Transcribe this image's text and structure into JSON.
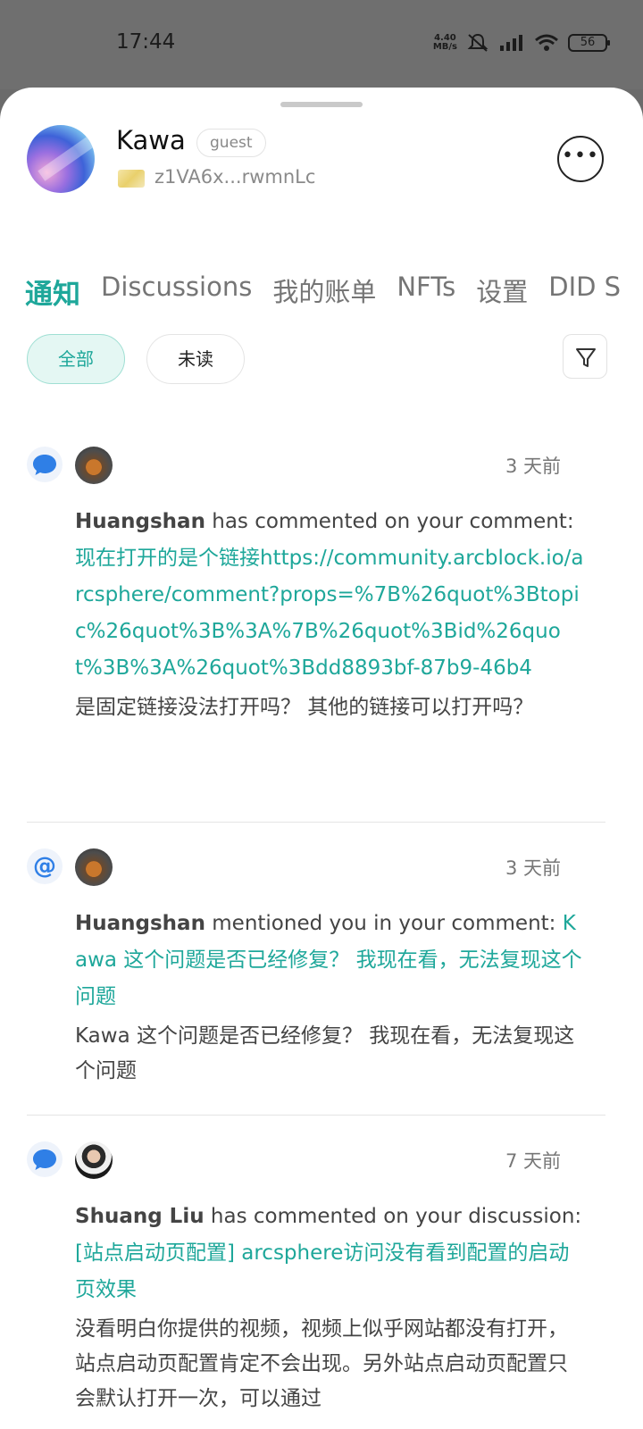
{
  "status": {
    "time": "17:44",
    "speed_top": "4.40",
    "speed_bottom": "MB/s",
    "battery": "56"
  },
  "profile": {
    "name": "Kawa",
    "role": "guest",
    "address": "z1VA6x...rwmnLc"
  },
  "tabs": [
    "通知",
    "Discussions",
    "我的账单",
    "NFTs",
    "设置",
    "DID S"
  ],
  "filters": [
    "全部",
    "未读"
  ],
  "notifications": [
    {
      "type": "comment",
      "time": "3 天前",
      "user": "Huangshan",
      "action": " has commented on your comment: ",
      "link": "现在打开的是个链接https://community.arcblock.io/arcsphere/comment?props=%7B%26quot%3Btopic%26quot%3B%3A%7B%26quot%3Bid%26quot%3B%3A%26quot%3Bdd8893bf-87b9-46b4",
      "extra": "是固定链接没法打开吗？ 其他的链接可以打开吗？"
    },
    {
      "type": "mention",
      "time": "3 天前",
      "user": "Huangshan",
      "action": " mentioned you in your comment: ",
      "link": "Kawa 这个问题是否已经修复？ 我现在看，无法复现这个问题",
      "extra": "Kawa 这个问题是否已经修复？ 我现在看，无法复现这个问题"
    },
    {
      "type": "comment",
      "time": "7 天前",
      "user": "Shuang Liu",
      "action": " has commented on your discussion: ",
      "link": "[站点启动页配置] arcsphere访问没有看到配置的启动页效果",
      "extra": "没看明白你提供的视频，视频上似乎网站都没有打开，站点启动页配置肯定不会出现。另外站点启动页配置只会默认打开一次，可以通过"
    }
  ]
}
